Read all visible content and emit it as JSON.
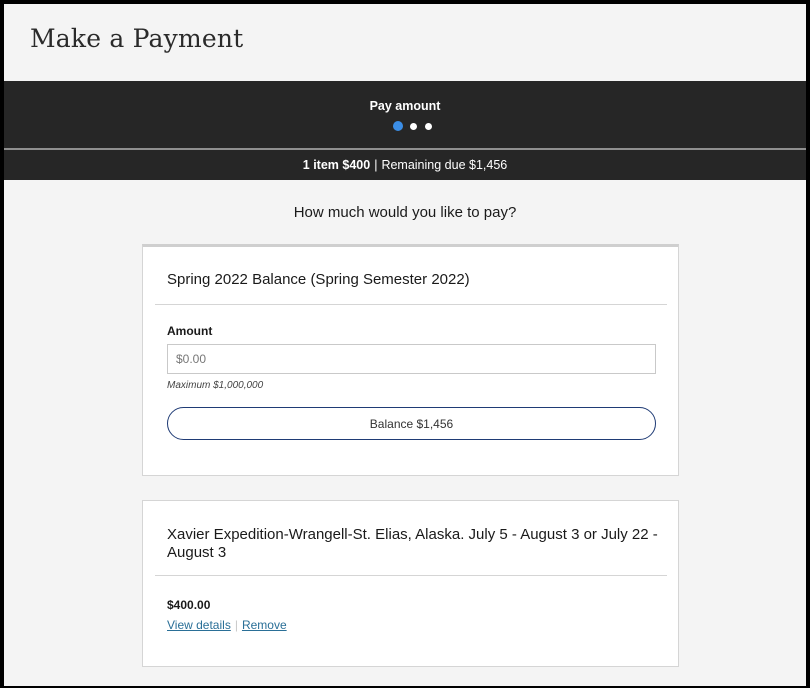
{
  "page": {
    "title": "Make a Payment"
  },
  "stepper": {
    "label": "Pay amount",
    "step_count": 3,
    "active_step": 1
  },
  "summary": {
    "items": "1 item $400",
    "separator": "|",
    "remaining": "Remaining due $1,456"
  },
  "question": "How much would you like to pay?",
  "balance_card": {
    "title": "Spring 2022 Balance (Spring Semester 2022)",
    "amount_label": "Amount",
    "amount_placeholder": "$0.00",
    "amount_value": "",
    "maximum_hint": "Maximum $1,000,000",
    "balance_button": "Balance $1,456"
  },
  "item_card": {
    "title": "Xavier Expedition-Wrangell-St. Elias, Alaska. July 5 - August 3 or July 22 - August 3",
    "amount": "$400.00",
    "view_details": "View details",
    "separator": "|",
    "remove": "Remove"
  },
  "colors": {
    "header_dark": "#262626",
    "active_dot": "#3b8ee6",
    "button_border": "#1f3b75",
    "link": "#2a6f97"
  }
}
